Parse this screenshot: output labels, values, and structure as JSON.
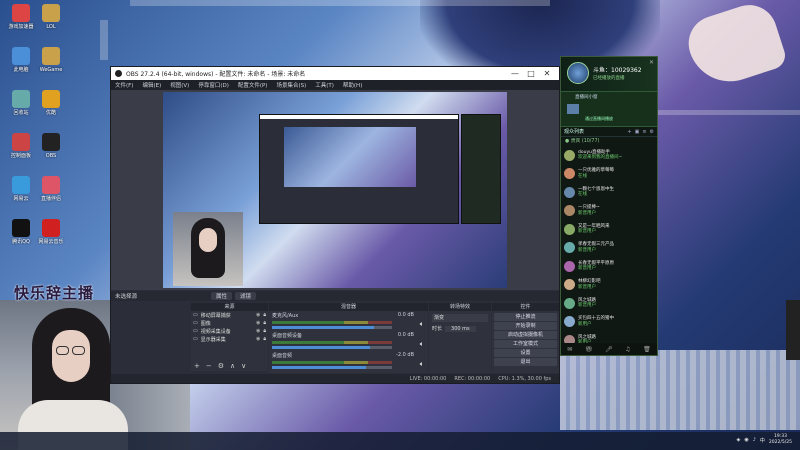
{
  "desktop": {
    "icons": [
      {
        "label": "游戏加速器",
        "icon": "app-icon",
        "color": "#d44"
      },
      {
        "label": "LOL",
        "icon": "game-icon",
        "color": "#c9a14a"
      },
      {
        "label": "此电脑",
        "icon": "computer-icon",
        "color": "#4a8fd8"
      },
      {
        "label": "WeGame",
        "icon": "game-icon",
        "color": "#c9a14a"
      },
      {
        "label": "回收站",
        "icon": "recycle-icon",
        "color": "#6aa"
      },
      {
        "label": "优酷",
        "icon": "video-icon",
        "color": "#e0a020"
      },
      {
        "label": "控制面板",
        "icon": "control-icon",
        "color": "#c44"
      },
      {
        "label": "OBS",
        "icon": "obs-icon",
        "color": "#222"
      },
      {
        "label": "网易云",
        "icon": "cloud-icon",
        "color": "#3a9bdc"
      },
      {
        "label": "直播伴侣",
        "icon": "live-icon",
        "color": "#d56"
      },
      {
        "label": "腾讯QQ",
        "icon": "qq-icon",
        "color": "#111"
      },
      {
        "label": "网易云音乐",
        "icon": "music-icon",
        "color": "#d02020"
      }
    ],
    "watermark": "快乐辞主播"
  },
  "obs": {
    "title": "OBS 27.2.4 (64-bit, windows) - 配置文件: 未命名 - 场景: 未命名",
    "window_buttons": [
      "—",
      "□",
      "✕"
    ],
    "menu": [
      "文件(F)",
      "编辑(E)",
      "视图(V)",
      "停靠窗口(D)",
      "配置文件(P)",
      "场景集合(S)",
      "工具(T)",
      "帮助(H)"
    ],
    "scene_label": "未选择源",
    "scene_buttons": [
      "属性",
      "滤镜"
    ],
    "docks": {
      "sources": "来源",
      "mixer": "混音器",
      "transitions": "转场特效",
      "controls": "控件"
    },
    "sources": [
      {
        "name": "移动屏幕捕获",
        "icon": "monitor-icon"
      },
      {
        "name": "图像",
        "icon": "image-icon"
      },
      {
        "name": "视频采集设备",
        "icon": "camera-icon"
      },
      {
        "name": "显示器采集",
        "icon": "display-icon"
      }
    ],
    "mixer": [
      {
        "name": "麦克风/Aux",
        "db": "0.0 dB",
        "level": 0.85
      },
      {
        "name": "桌面音频设备",
        "db": "0.0 dB",
        "level": 0.82
      },
      {
        "name": "桌面音频",
        "db": "-2.0 dB",
        "level": 0.78
      }
    ],
    "transition": {
      "type": "渐变",
      "duration_label": "时长",
      "duration": "300 ms"
    },
    "controls": [
      "停止推流",
      "开始录制",
      "启动虚拟摄像机",
      "工作室模式",
      "设置",
      "退出"
    ],
    "status": {
      "live": "LIVE: 00:00:00",
      "rec": "REC: 00:00:00",
      "cpu": "CPU: 1.3%, 30.00 fps"
    }
  },
  "assistant": {
    "username": "斗鱼：10029362",
    "subtitle": "已经播放的直播",
    "room_title": "直播间小窗",
    "room_status": "通过直播间播放",
    "tab": "观众列表",
    "group": "● 贵宾 (10/77)",
    "chat": [
      {
        "user": "douyu直播助手",
        "msg": "欢迎来到我的直播间~",
        "color": "#9a6"
      },
      {
        "user": "一只优雅的草莓莓",
        "msg": "在线",
        "color": "#c86"
      },
      {
        "user": "一颗七个恩恩中生",
        "msg": "在线",
        "color": "#68a"
      },
      {
        "user": "一只提棒~",
        "msg": "新晋用户",
        "color": "#a86"
      },
      {
        "user": "又是一年晒风来",
        "msg": "新晋用户",
        "color": "#8a6"
      },
      {
        "user": "孝春无假三元产品",
        "msg": "新晋用户",
        "color": "#6aa"
      },
      {
        "user": "长春无假平平原原",
        "msg": "新晋用户",
        "color": "#a6a"
      },
      {
        "user": "林柳幻影吧",
        "msg": "新晋用户",
        "color": "#ca8"
      },
      {
        "user": "风之城路",
        "msg": "新晋用户",
        "color": "#6a8"
      },
      {
        "user": "买包四十五的猪中",
        "msg": "新用户",
        "color": "#8ac"
      },
      {
        "user": "风之城路",
        "msg": "新用户",
        "color": "#a88"
      }
    ],
    "footer_icons": [
      "message-icon",
      "gift-icon",
      "mic-icon",
      "music-icon",
      "trash-icon"
    ]
  },
  "taskbar": {
    "time": "19:33",
    "date": "2022/5/25"
  }
}
